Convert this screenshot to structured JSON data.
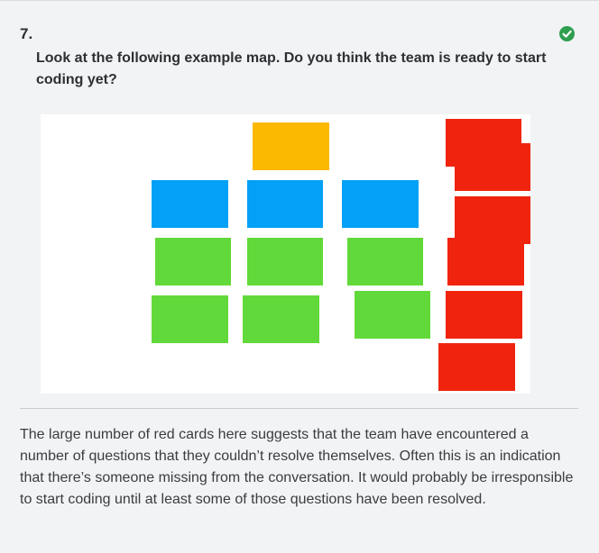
{
  "question": {
    "number": "7.",
    "text": "Look at the following example map. Do you think the team is ready to start coding yet?",
    "status_icon": "check-circle-icon"
  },
  "example_map": {
    "colors": {
      "story": "#fbb901",
      "rule": "#02a0f7",
      "example": "#62d93a",
      "question": "#f0240e"
    },
    "counts": {
      "story_cards": 1,
      "rule_cards": 3,
      "example_cards": 6,
      "question_cards": 6
    }
  },
  "feedback": {
    "text": "The large number of red cards here suggests that the team have encountered a number of questions that they couldn’t resolve themselves. Often this is an indication that there’s someone missing from the conversation. It would probably be irresponsible to start coding until at least some of those questions have been resolved."
  },
  "colors": {
    "background": "#f2f3f5",
    "correct": "#2e9e4f",
    "text": "#2d2f33"
  }
}
